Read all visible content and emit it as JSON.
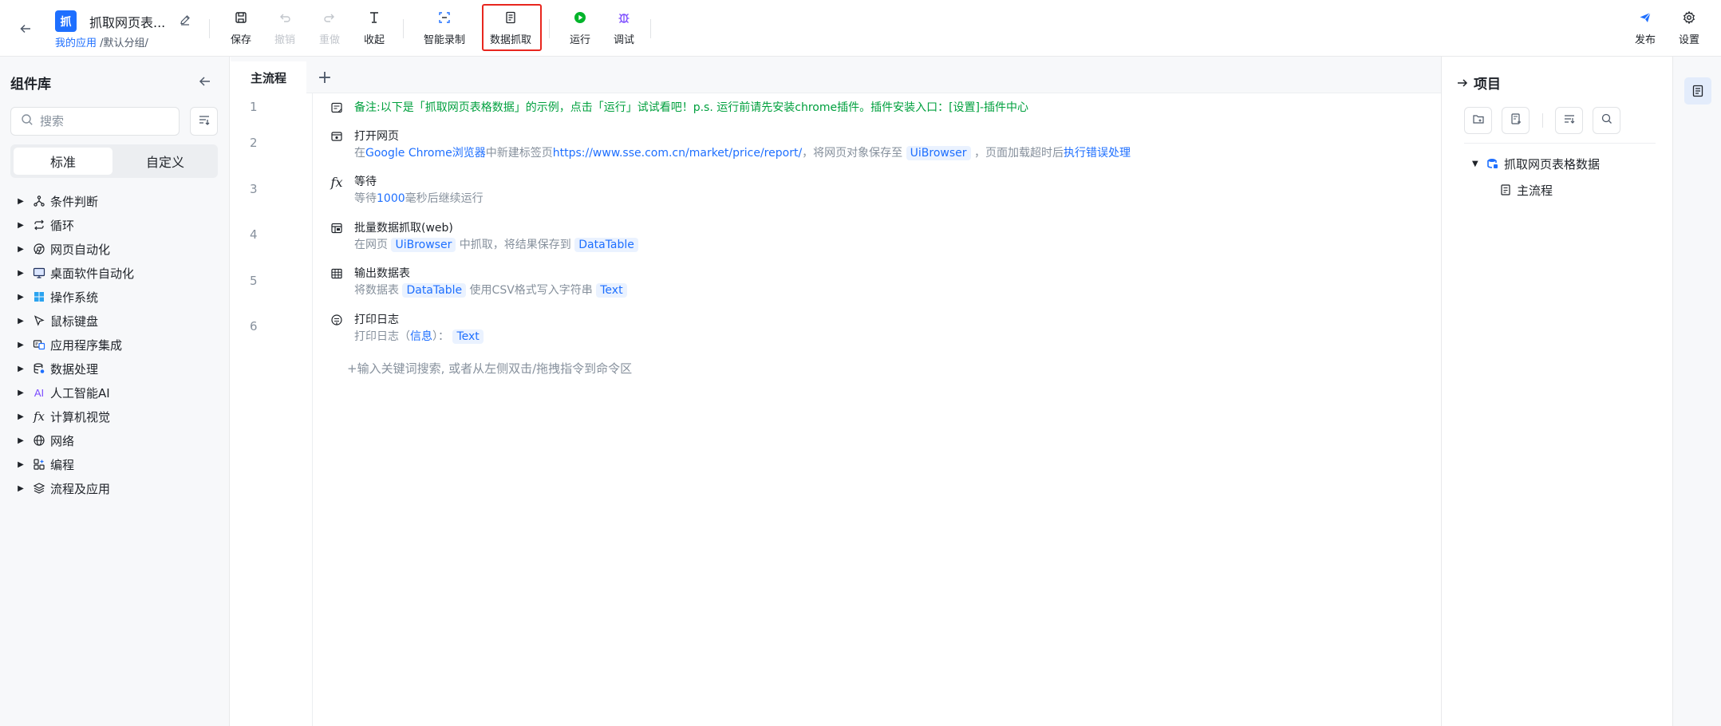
{
  "app": {
    "avatar_text": "抓",
    "title": "抓取网页表...",
    "breadcrumb_link": "我的应用",
    "breadcrumb_rest": " /默认分组/"
  },
  "toolbar": {
    "save": "保存",
    "undo": "撤销",
    "redo": "重做",
    "collapse": "收起",
    "smart_record": "智能录制",
    "data_scrape": "数据抓取",
    "run": "运行",
    "debug": "调试",
    "publish": "发布",
    "settings": "设置"
  },
  "colors": {
    "accent": "#1e6fff",
    "note_green": "#00a03e",
    "run_green": "#00b42a",
    "debug_purple": "#7b4bff",
    "highlight_red": "#e8261e"
  },
  "left_panel": {
    "title": "组件库",
    "search_placeholder": "搜索",
    "tab_standard": "标准",
    "tab_custom": "自定义",
    "categories": [
      {
        "label": "条件判断",
        "icon": "branch-icon"
      },
      {
        "label": "循环",
        "icon": "loop-icon"
      },
      {
        "label": "网页自动化",
        "icon": "chrome-icon"
      },
      {
        "label": "桌面软件自动化",
        "icon": "desktop-icon"
      },
      {
        "label": "操作系统",
        "icon": "windows-icon"
      },
      {
        "label": "鼠标键盘",
        "icon": "cursor-icon"
      },
      {
        "label": "应用程序集成",
        "icon": "app-integration-icon"
      },
      {
        "label": "数据处理",
        "icon": "database-icon"
      },
      {
        "label": "人工智能AI",
        "icon": "ai-icon",
        "icon_text": "AI"
      },
      {
        "label": "计算机视觉",
        "icon": "fx-icon"
      },
      {
        "label": "网络",
        "icon": "globe-icon"
      },
      {
        "label": "编程",
        "icon": "code-blocks-icon"
      },
      {
        "label": "流程及应用",
        "icon": "layers-icon"
      }
    ]
  },
  "editor": {
    "tab_main": "主流程",
    "line_numbers": [
      "1",
      "2",
      "3",
      "4",
      "5",
      "6"
    ],
    "note": "备注:以下是「抓取网页表格数据」的示例，点击「运行」试试看吧！p.s. 运行前请先安装chrome插件。插件安装入口：[设置]-插件中心",
    "s2": {
      "title": "打开网页",
      "d_prefix": "在",
      "d_browser": "Google Chrome浏览器",
      "d_mid": "中新建标签页",
      "d_url": "https://www.sse.com.cn/market/price/report/",
      "d_mid2": "，将网页对象保存至",
      "d_var": "UiBrowser",
      "d_mid3": "，页面加载超时后",
      "d_err": "执行错误处理"
    },
    "s3": {
      "title": "等待",
      "d_prefix": "等待",
      "d_num": "1000",
      "d_suffix": "毫秒后继续运行"
    },
    "s4": {
      "title": "批量数据抓取(web)",
      "d_prefix": "在网页",
      "d_var1": "UiBrowser",
      "d_mid": "中抓取，将结果保存到",
      "d_var2": "DataTable"
    },
    "s5": {
      "title": "输出数据表",
      "d_prefix": "将数据表",
      "d_var1": "DataTable",
      "d_mid": "使用CSV格式写入字符串",
      "d_var2": "Text"
    },
    "s6": {
      "title": "打印日志",
      "d_prefix": "打印日志（",
      "d_info": "信息",
      "d_mid": "）：",
      "d_var": "Text"
    },
    "command_placeholder": "+输入关键词搜索, 或者从左侧双击/拖拽指令到命令区"
  },
  "right_panel": {
    "title": "项目",
    "project_name": "抓取网页表格数据",
    "main_flow": "主流程"
  }
}
